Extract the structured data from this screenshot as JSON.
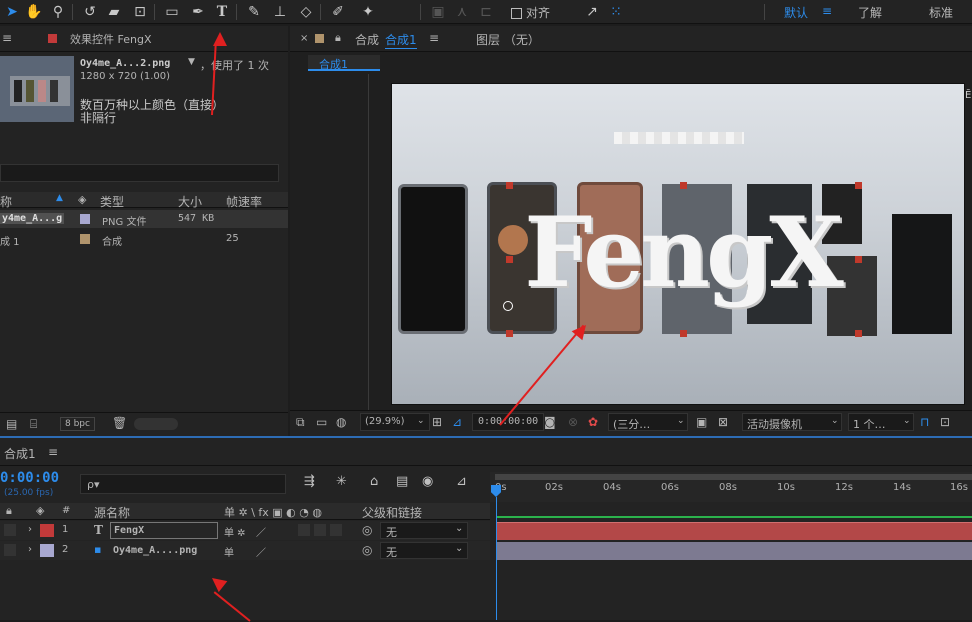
{
  "toolbar": {
    "align_label": "对齐",
    "workspace_default": "默认",
    "workspace_learn": "了解",
    "workspace_standard": "标准",
    "menu_icon": "≡"
  },
  "project": {
    "panel_tab": "≡",
    "effect_controls_title": "效果控件 FengX",
    "file_name": "Oy4me_A...2.png",
    "used_text": "，使用了 1 次",
    "dimensions": "1280 x 720 (1.00)",
    "color_text": "数百万种以上颜色（直接）",
    "interlace": "非隔行",
    "columns": {
      "name": "称",
      "type": "类型",
      "size": "大小",
      "fps": "帧速率"
    },
    "items": [
      {
        "name": "y4me_A...g",
        "type": "PNG 文件",
        "size": "547 KB",
        "fps": "",
        "color": "#a8a8d0"
      },
      {
        "name": "成 1",
        "type": "合成",
        "size": "",
        "fps": "25",
        "color": "#b0946c"
      }
    ],
    "bpc": "8 bpc"
  },
  "composition": {
    "close": "×",
    "tab_label": "合成",
    "tab_name": "合成1",
    "menu": "≡",
    "layer_tab": "图层 （无）",
    "breadcrumb": "合成1",
    "logo_text": "FengX",
    "zoom": "(29.9%)",
    "timecode": "0:00:00:00",
    "resolution": "(三分…",
    "camera": "活动摄像机",
    "views": "1 个…"
  },
  "timeline": {
    "comp_name": "合成1",
    "menu": "≡",
    "timecode": "0:00:00",
    "fps": "(25.00 fps)",
    "search_placeholder": "ρ▾",
    "col_num": "#",
    "col_source": "源名称",
    "col_switches": "单 ✲ \\ fx ▣ ◐ ◔ ◍",
    "col_parent": "父级和链接",
    "layers": [
      {
        "num": "1",
        "type": "T",
        "name": "FengX",
        "label_color": "#c23a3a",
        "parent": "无"
      },
      {
        "num": "2",
        "type": "▪",
        "name": "Oy4me_A....png",
        "label_color": "#a8a8d0",
        "parent": "无"
      }
    ],
    "ruler": [
      "0s",
      "02s",
      "04s",
      "06s",
      "08s",
      "10s",
      "12s",
      "14s",
      "16s"
    ]
  }
}
